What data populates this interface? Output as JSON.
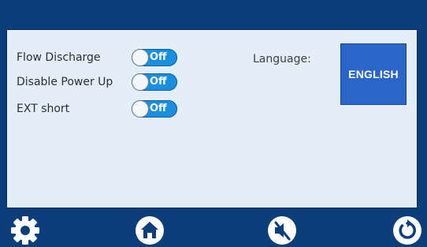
{
  "settings": {
    "rows": [
      {
        "label": "Flow Discharge",
        "state": "Off"
      },
      {
        "label": "Disable Power Up",
        "state": "Off"
      },
      {
        "label": "EXT short",
        "state": "Off"
      }
    ]
  },
  "language": {
    "label": "Language:",
    "button_label": "ENGLISH"
  },
  "bottom_bar": {
    "icons": [
      "gear-icon",
      "home-icon",
      "mute-icon",
      "refresh-icon"
    ]
  },
  "colors": {
    "frame": "#0c3f7a",
    "panel": "#e3eef8",
    "toggle": "#1a8fe0",
    "button": "#2a66c8"
  }
}
